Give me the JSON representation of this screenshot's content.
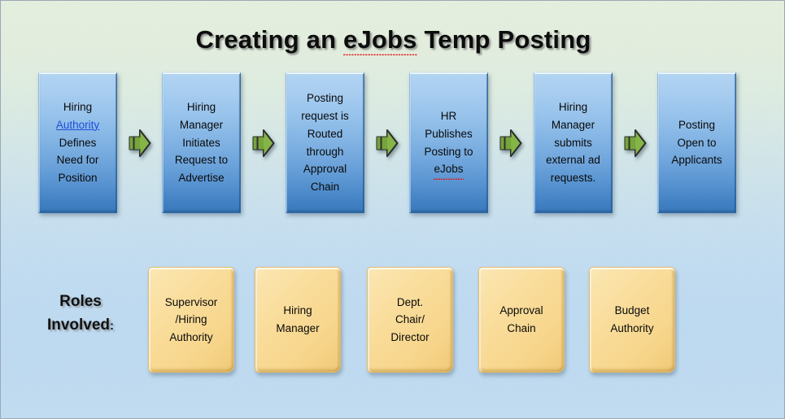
{
  "slide": {
    "title_prefix": "Creating an ",
    "title_misspelled": "eJobs",
    "title_suffix": " Temp Posting",
    "background_top_color": "#e3eedd",
    "background_bottom_color": "#c0dbf0",
    "border_color": "#9aa8b5"
  },
  "process": {
    "box_fill_top": "#b2d4f2",
    "box_fill_bottom": "#3a79bb",
    "arrow_color": "#7aab3f",
    "arrow_icon_name": "right-arrow-icon",
    "steps": [
      {
        "id": "step-1",
        "line1": "Hiring",
        "link": "Authority",
        "line3": "Defines",
        "line4": "Need for",
        "line5": "Position"
      },
      {
        "id": "step-2",
        "line1": "Hiring",
        "line2": "Manager",
        "line3": "Initiates",
        "line4": "Request to",
        "line5": "Advertise"
      },
      {
        "id": "step-3",
        "line1": "Posting",
        "line2": "request is",
        "line3": "Routed",
        "line4": "through",
        "line5": "Approval",
        "line6": "Chain"
      },
      {
        "id": "step-4",
        "line1": "HR",
        "line2": "Publishes",
        "line3": "Posting to",
        "misspelled": "eJobs"
      },
      {
        "id": "step-5",
        "line1": "Hiring",
        "line2": "Manager",
        "line3": "submits",
        "line4": "external ad",
        "line5": "requests."
      },
      {
        "id": "step-6",
        "line1": "Posting",
        "line2": "Open to",
        "line3": "Applicants"
      }
    ]
  },
  "roles": {
    "label_line1": "Roles",
    "label_line2": "Involved",
    "label_colon": ":",
    "box_fill_top": "#fbe8b5",
    "box_fill_bottom": "#eec877",
    "items": [
      {
        "id": "role-1",
        "line1": "Supervisor",
        "line2": "/Hiring",
        "line3": "Authority"
      },
      {
        "id": "role-2",
        "line1": "Hiring",
        "line2": "Manager"
      },
      {
        "id": "role-3",
        "line1": "Dept.",
        "line2": "Chair/",
        "line3": "Director"
      },
      {
        "id": "role-4",
        "line1": "Approval",
        "line2": "Chain"
      },
      {
        "id": "role-5",
        "line1": "Budget",
        "line2": "Authority"
      }
    ]
  }
}
